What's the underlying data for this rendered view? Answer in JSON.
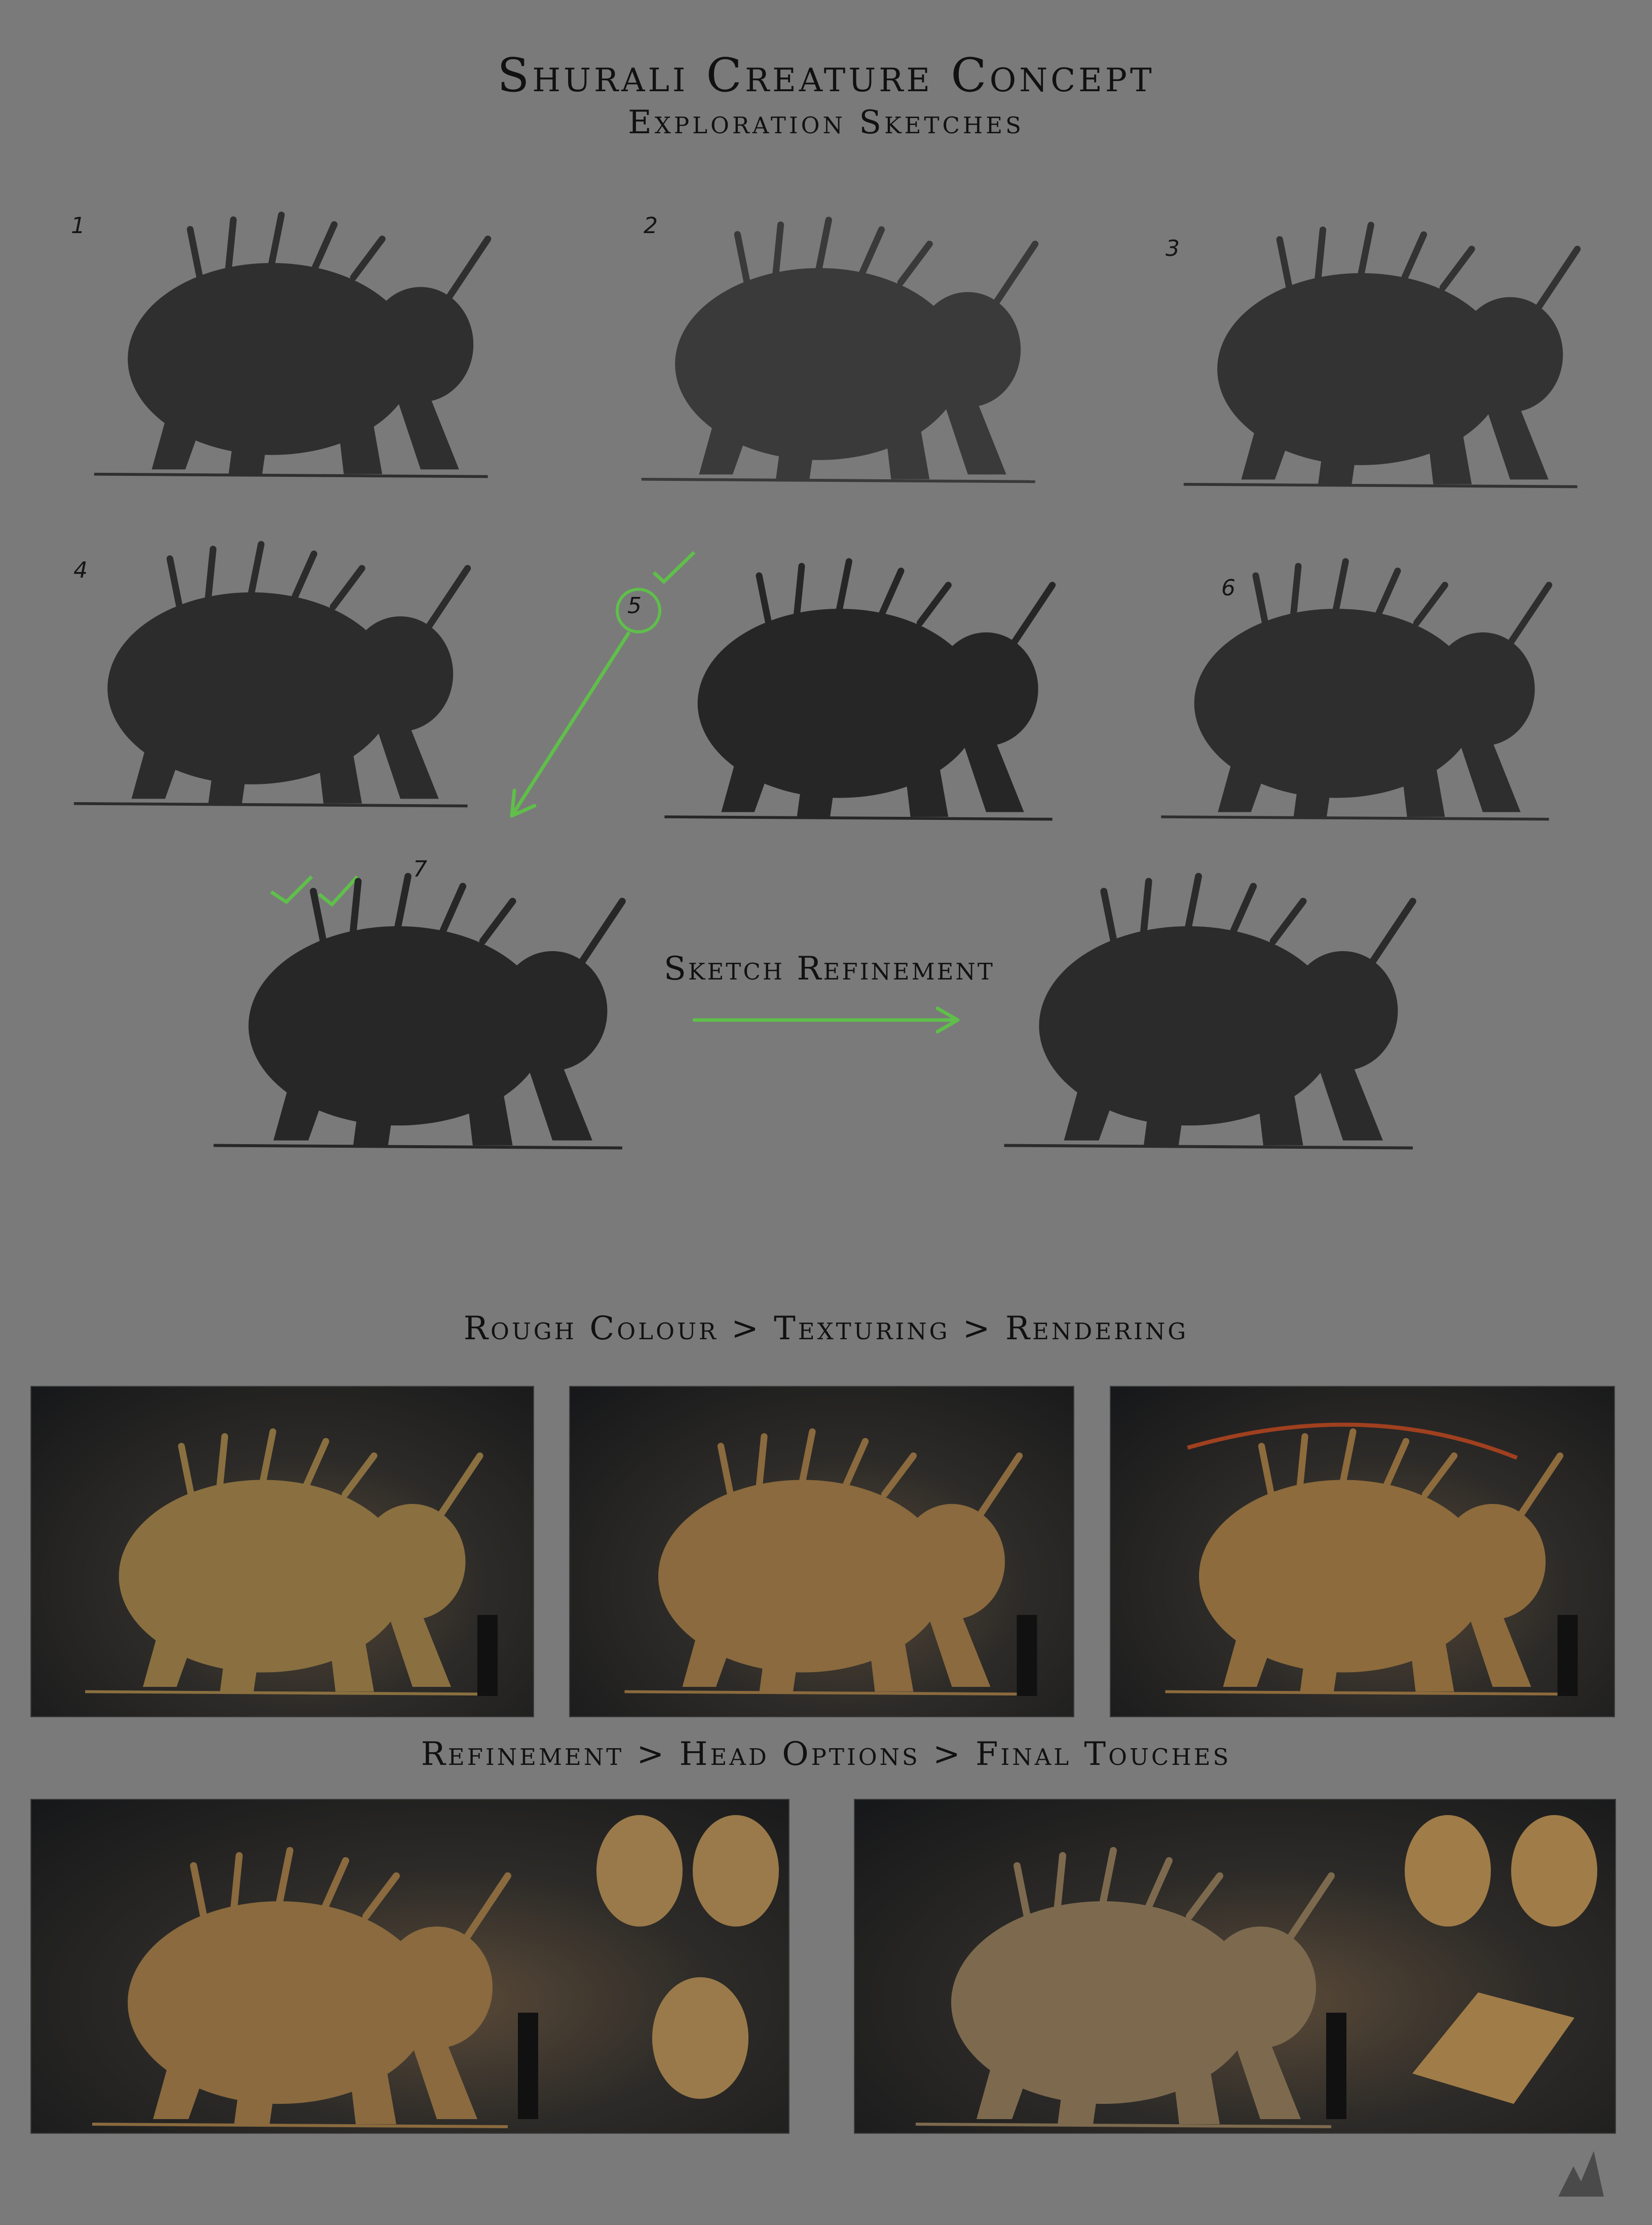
{
  "title": "Shurali Creature Concept",
  "subtitle": "Exploration Sketches",
  "sketches": [
    {
      "number": "1"
    },
    {
      "number": "2"
    },
    {
      "number": "3"
    },
    {
      "number": "4"
    },
    {
      "number": "5",
      "circled": true,
      "checkmarks": 1
    },
    {
      "number": "6"
    },
    {
      "number": "7",
      "checkmarks": 2
    }
  ],
  "refinement_label": "Sketch Refinement",
  "colour_heading": "Rough Colour > Texturing > Rendering",
  "refine_heading": "Refinement > Head Options > Final Touches",
  "colors": {
    "background": "#7a7a7a",
    "annotation_green": "#5fbf4a",
    "creature_wood": "#8a6a3e"
  }
}
